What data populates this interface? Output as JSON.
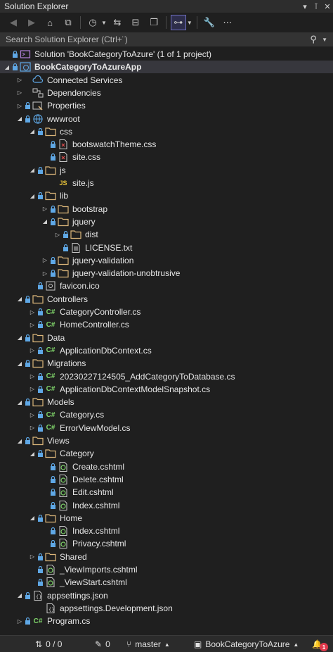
{
  "window": {
    "title": "Solution Explorer"
  },
  "search": {
    "placeholder": "Search Solution Explorer (Ctrl+¨)"
  },
  "tree": [
    {
      "label": "Solution 'BookCategoryToAzure' (1 of 1 project)",
      "icon": "solution-icon",
      "depth": 0,
      "expander": "none",
      "lock": true,
      "bold": false
    },
    {
      "label": "BookCategoryToAzureApp",
      "icon": "web-project-icon",
      "depth": 0,
      "expander": "expanded",
      "lock": true,
      "bold": true,
      "selected": true
    },
    {
      "label": "Connected Services",
      "icon": "connected-services-icon",
      "depth": 1,
      "expander": "collapsed",
      "lock": false
    },
    {
      "label": "Dependencies",
      "icon": "dependencies-icon",
      "depth": 1,
      "expander": "collapsed",
      "lock": false
    },
    {
      "label": "Properties",
      "icon": "properties-icon",
      "depth": 1,
      "expander": "collapsed",
      "lock": true
    },
    {
      "label": "wwwroot",
      "icon": "globe-icon",
      "depth": 1,
      "expander": "expanded",
      "lock": true
    },
    {
      "label": "css",
      "icon": "folder-icon",
      "depth": 2,
      "expander": "expanded",
      "lock": true
    },
    {
      "label": "bootswatchTheme.css",
      "icon": "css-file-icon",
      "depth": 3,
      "expander": "none",
      "lock": true
    },
    {
      "label": "site.css",
      "icon": "css-file-icon",
      "depth": 3,
      "expander": "none",
      "lock": true
    },
    {
      "label": "js",
      "icon": "folder-icon",
      "depth": 2,
      "expander": "expanded",
      "lock": true
    },
    {
      "label": "site.js",
      "icon": "js-file-icon",
      "depth": 3,
      "expander": "none",
      "lock": false
    },
    {
      "label": "lib",
      "icon": "folder-icon",
      "depth": 2,
      "expander": "expanded",
      "lock": true
    },
    {
      "label": "bootstrap",
      "icon": "folder-icon",
      "depth": 3,
      "expander": "collapsed",
      "lock": true
    },
    {
      "label": "jquery",
      "icon": "folder-icon",
      "depth": 3,
      "expander": "expanded",
      "lock": true
    },
    {
      "label": "dist",
      "icon": "folder-icon",
      "depth": 4,
      "expander": "collapsed",
      "lock": true
    },
    {
      "label": "LICENSE.txt",
      "icon": "text-file-icon",
      "depth": 4,
      "expander": "none",
      "lock": true
    },
    {
      "label": "jquery-validation",
      "icon": "folder-icon",
      "depth": 3,
      "expander": "collapsed",
      "lock": true
    },
    {
      "label": "jquery-validation-unobtrusive",
      "icon": "folder-icon",
      "depth": 3,
      "expander": "collapsed",
      "lock": true
    },
    {
      "label": "favicon.ico",
      "icon": "image-file-icon",
      "depth": 2,
      "expander": "none",
      "lock": true
    },
    {
      "label": "Controllers",
      "icon": "folder-icon",
      "depth": 1,
      "expander": "expanded",
      "lock": true
    },
    {
      "label": "CategoryController.cs",
      "icon": "csharp-file-icon",
      "depth": 2,
      "expander": "collapsed",
      "lock": true
    },
    {
      "label": "HomeController.cs",
      "icon": "csharp-file-icon",
      "depth": 2,
      "expander": "collapsed",
      "lock": true
    },
    {
      "label": "Data",
      "icon": "folder-icon",
      "depth": 1,
      "expander": "expanded",
      "lock": true
    },
    {
      "label": "ApplicationDbContext.cs",
      "icon": "csharp-file-icon",
      "depth": 2,
      "expander": "collapsed",
      "lock": true
    },
    {
      "label": "Migrations",
      "icon": "folder-icon",
      "depth": 1,
      "expander": "expanded",
      "lock": true
    },
    {
      "label": "20230227124505_AddCategoryToDatabase.cs",
      "icon": "csharp-file-icon",
      "depth": 2,
      "expander": "collapsed",
      "lock": true
    },
    {
      "label": "ApplicationDbContextModelSnapshot.cs",
      "icon": "csharp-file-icon",
      "depth": 2,
      "expander": "collapsed",
      "lock": true
    },
    {
      "label": "Models",
      "icon": "folder-icon",
      "depth": 1,
      "expander": "expanded",
      "lock": true
    },
    {
      "label": "Category.cs",
      "icon": "csharp-file-icon",
      "depth": 2,
      "expander": "collapsed",
      "lock": true
    },
    {
      "label": "ErrorViewModel.cs",
      "icon": "csharp-file-icon",
      "depth": 2,
      "expander": "collapsed",
      "lock": true
    },
    {
      "label": "Views",
      "icon": "folder-icon",
      "depth": 1,
      "expander": "expanded",
      "lock": true
    },
    {
      "label": "Category",
      "icon": "folder-icon",
      "depth": 2,
      "expander": "expanded",
      "lock": true
    },
    {
      "label": "Create.cshtml",
      "icon": "razor-file-icon",
      "depth": 3,
      "expander": "none",
      "lock": true
    },
    {
      "label": "Delete.cshtml",
      "icon": "razor-file-icon",
      "depth": 3,
      "expander": "none",
      "lock": true
    },
    {
      "label": "Edit.cshtml",
      "icon": "razor-file-icon",
      "depth": 3,
      "expander": "none",
      "lock": true
    },
    {
      "label": "Index.cshtml",
      "icon": "razor-file-icon",
      "depth": 3,
      "expander": "none",
      "lock": true
    },
    {
      "label": "Home",
      "icon": "folder-icon",
      "depth": 2,
      "expander": "expanded",
      "lock": true
    },
    {
      "label": "Index.cshtml",
      "icon": "razor-file-icon",
      "depth": 3,
      "expander": "none",
      "lock": true
    },
    {
      "label": "Privacy.cshtml",
      "icon": "razor-file-icon",
      "depth": 3,
      "expander": "none",
      "lock": true
    },
    {
      "label": "Shared",
      "icon": "folder-icon",
      "depth": 2,
      "expander": "collapsed",
      "lock": true
    },
    {
      "label": "_ViewImports.cshtml",
      "icon": "razor-file-icon",
      "depth": 2,
      "expander": "none",
      "lock": true
    },
    {
      "label": "_ViewStart.cshtml",
      "icon": "razor-file-icon",
      "depth": 2,
      "expander": "none",
      "lock": true
    },
    {
      "label": "appsettings.json",
      "icon": "json-file-icon",
      "depth": 1,
      "expander": "expanded",
      "lock": true
    },
    {
      "label": "appsettings.Development.json",
      "icon": "json-file-icon",
      "depth": 2,
      "expander": "none",
      "lock": false
    },
    {
      "label": "Program.cs",
      "icon": "csharp-file-icon",
      "depth": 1,
      "expander": "collapsed",
      "lock": true
    }
  ],
  "status": {
    "changes": "0 / 0",
    "edits": "0",
    "branch": "master",
    "repo": "BookCategoryToAzure",
    "notifications": "1"
  }
}
